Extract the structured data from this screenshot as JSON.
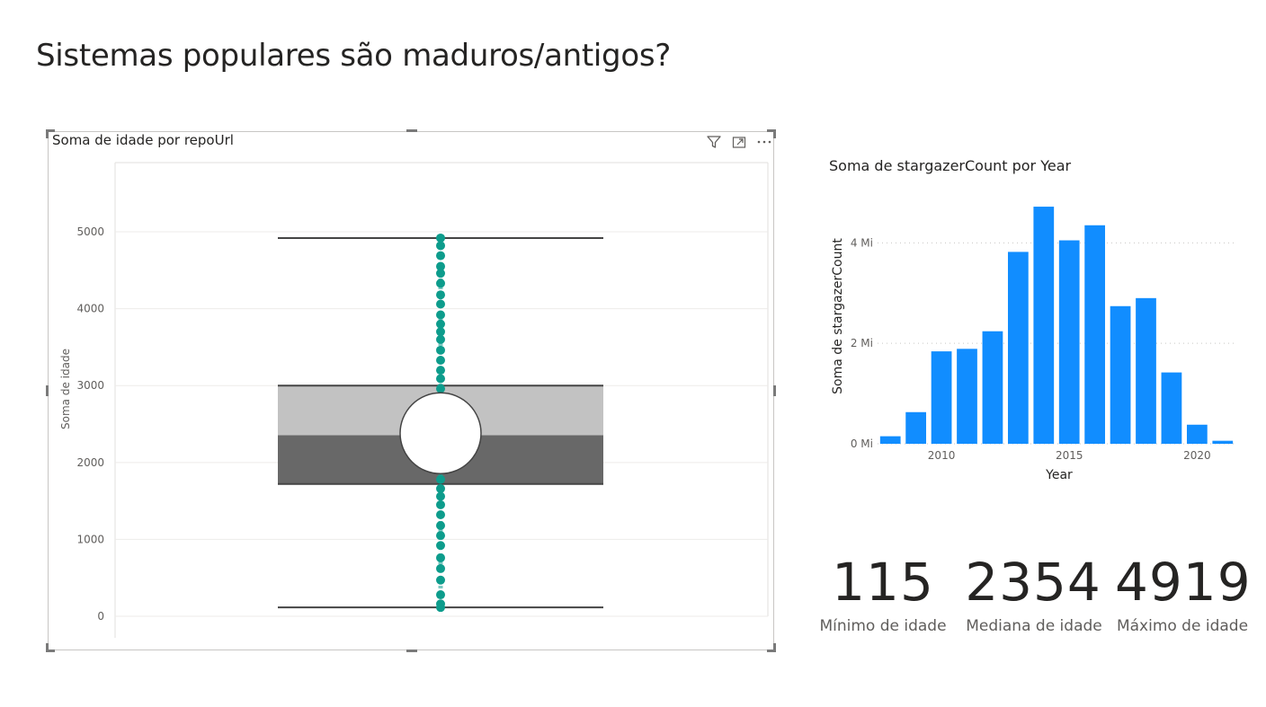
{
  "page": {
    "title": "Sistemas populares são maduros/antigos?"
  },
  "boxplot_visual": {
    "title": "Soma de idade por repoUrl",
    "icons": [
      "filter-icon",
      "focus-mode-icon",
      "more-options-icon"
    ],
    "chart_data": {
      "type": "boxplot",
      "ylabel": "Soma de idade",
      "ylim": [
        0,
        5900
      ],
      "yticks": [
        0,
        1000,
        2000,
        3000,
        4000,
        5000
      ],
      "whisker_low": 115,
      "q1": 1720,
      "median": 2354,
      "q3": 3000,
      "whisker_high": 4919,
      "mean": 2380,
      "points": [
        115,
        160,
        280,
        470,
        620,
        760,
        920,
        1050,
        1180,
        1320,
        1450,
        1560,
        1660,
        1780,
        2960,
        3090,
        3200,
        3330,
        3460,
        3600,
        3700,
        3800,
        3920,
        4060,
        4180,
        4330,
        4460,
        4550,
        4690,
        4820,
        4919
      ],
      "grid": true
    }
  },
  "bar_visual": {
    "chart_data": {
      "type": "bar",
      "title": "Soma de stargazerCount por Year",
      "xlabel": "Year",
      "ylabel": "Soma de stargazerCount",
      "categories": [
        2008,
        2009,
        2010,
        2011,
        2012,
        2013,
        2014,
        2015,
        2016,
        2017,
        2018,
        2019,
        2020,
        2021
      ],
      "values": [
        0.15,
        0.63,
        1.84,
        1.89,
        2.24,
        3.82,
        4.72,
        4.05,
        4.35,
        2.74,
        2.9,
        1.42,
        0.38,
        0.06
      ],
      "unit": "Mi",
      "ylim": [
        0,
        4.9
      ],
      "yticks": [
        {
          "v": 0,
          "label": "0 Mi"
        },
        {
          "v": 2,
          "label": "2 Mi"
        },
        {
          "v": 4,
          "label": "4 Mi"
        }
      ],
      "xticks": [
        2010,
        2015,
        2020
      ],
      "xlim": [
        2007.5,
        2021.5
      ],
      "color": "#118dff",
      "grid": true
    }
  },
  "cards": [
    {
      "value": "115",
      "label": "Mínimo de idade"
    },
    {
      "value": "2354",
      "label": "Mediana de idade"
    },
    {
      "value": "4919",
      "label": "Máximo de idade"
    }
  ]
}
